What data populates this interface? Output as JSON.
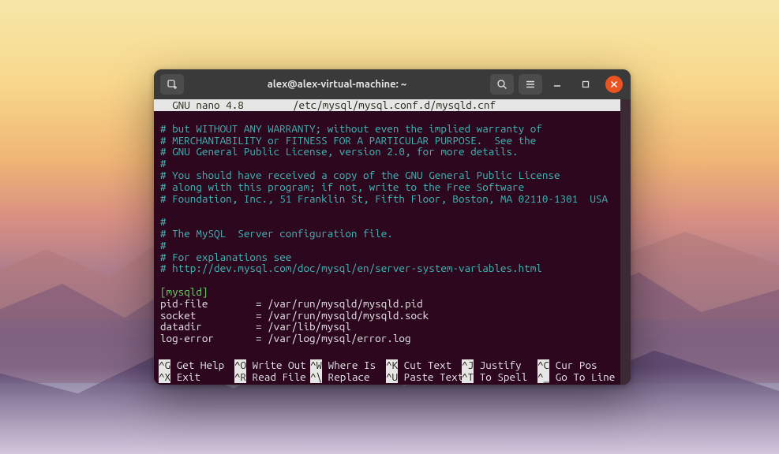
{
  "window": {
    "title": "alex@alex-virtual-machine: ~"
  },
  "icons": {
    "tab": "tab-icon",
    "search": "search-icon",
    "menu": "hamburger-icon",
    "min": "minimize-icon",
    "max": "maximize-icon",
    "close": "close-icon"
  },
  "nano": {
    "app": "  GNU nano 4.8",
    "file": "/etc/mysql/mysql.conf.d/mysqld.cnf"
  },
  "lines": {
    "l01": "# but WITHOUT ANY WARRANTY; without even the implied warranty of",
    "l02": "# MERCHANTABILITY or FITNESS FOR A PARTICULAR PURPOSE.  See the",
    "l03": "# GNU General Public License, version 2.0, for more details.",
    "l04": "#",
    "l05": "# You should have received a copy of the GNU General Public License",
    "l06": "# along with this program; if not, write to the Free Software",
    "l07": "# Foundation, Inc., 51 Franklin St, Fifth Floor, Boston, MA 02110-1301  USA",
    "l08": "",
    "l09": "#",
    "l10": "# The MySQL  Server configuration file.",
    "l11": "#",
    "l12": "# For explanations see",
    "l13": "# http://dev.mysql.com/doc/mysql/en/server-system-variables.html",
    "l14": "",
    "l15": "[mysqld]",
    "l16": "pid-file        = /var/run/mysqld/mysqld.pid",
    "l17": "socket          = /var/run/mysqld/mysqld.sock",
    "l18": "datadir         = /var/lib/mysql",
    "l19": "log-error       = /var/log/mysql/error.log"
  },
  "shortcuts": {
    "r1": {
      "k0": "^G",
      "t0": " Get Help  ",
      "k1": "^O",
      "t1": " Write Out ",
      "k2": "^W",
      "t2": " Where Is  ",
      "k3": "^K",
      "t3": " Cut Text  ",
      "k4": "^J",
      "t4": " Justify   ",
      "k5": "^C",
      "t5": " Cur Pos"
    },
    "r2": {
      "k0": "^X",
      "t0": " Exit      ",
      "k1": "^R",
      "t1": " Read File ",
      "k2": "^\\",
      "t2": " Replace   ",
      "k3": "^U",
      "t3": " Paste Text",
      "k4": "^T",
      "t4": " To Spell  ",
      "k5": "^_",
      "t5": " Go To Line"
    }
  }
}
